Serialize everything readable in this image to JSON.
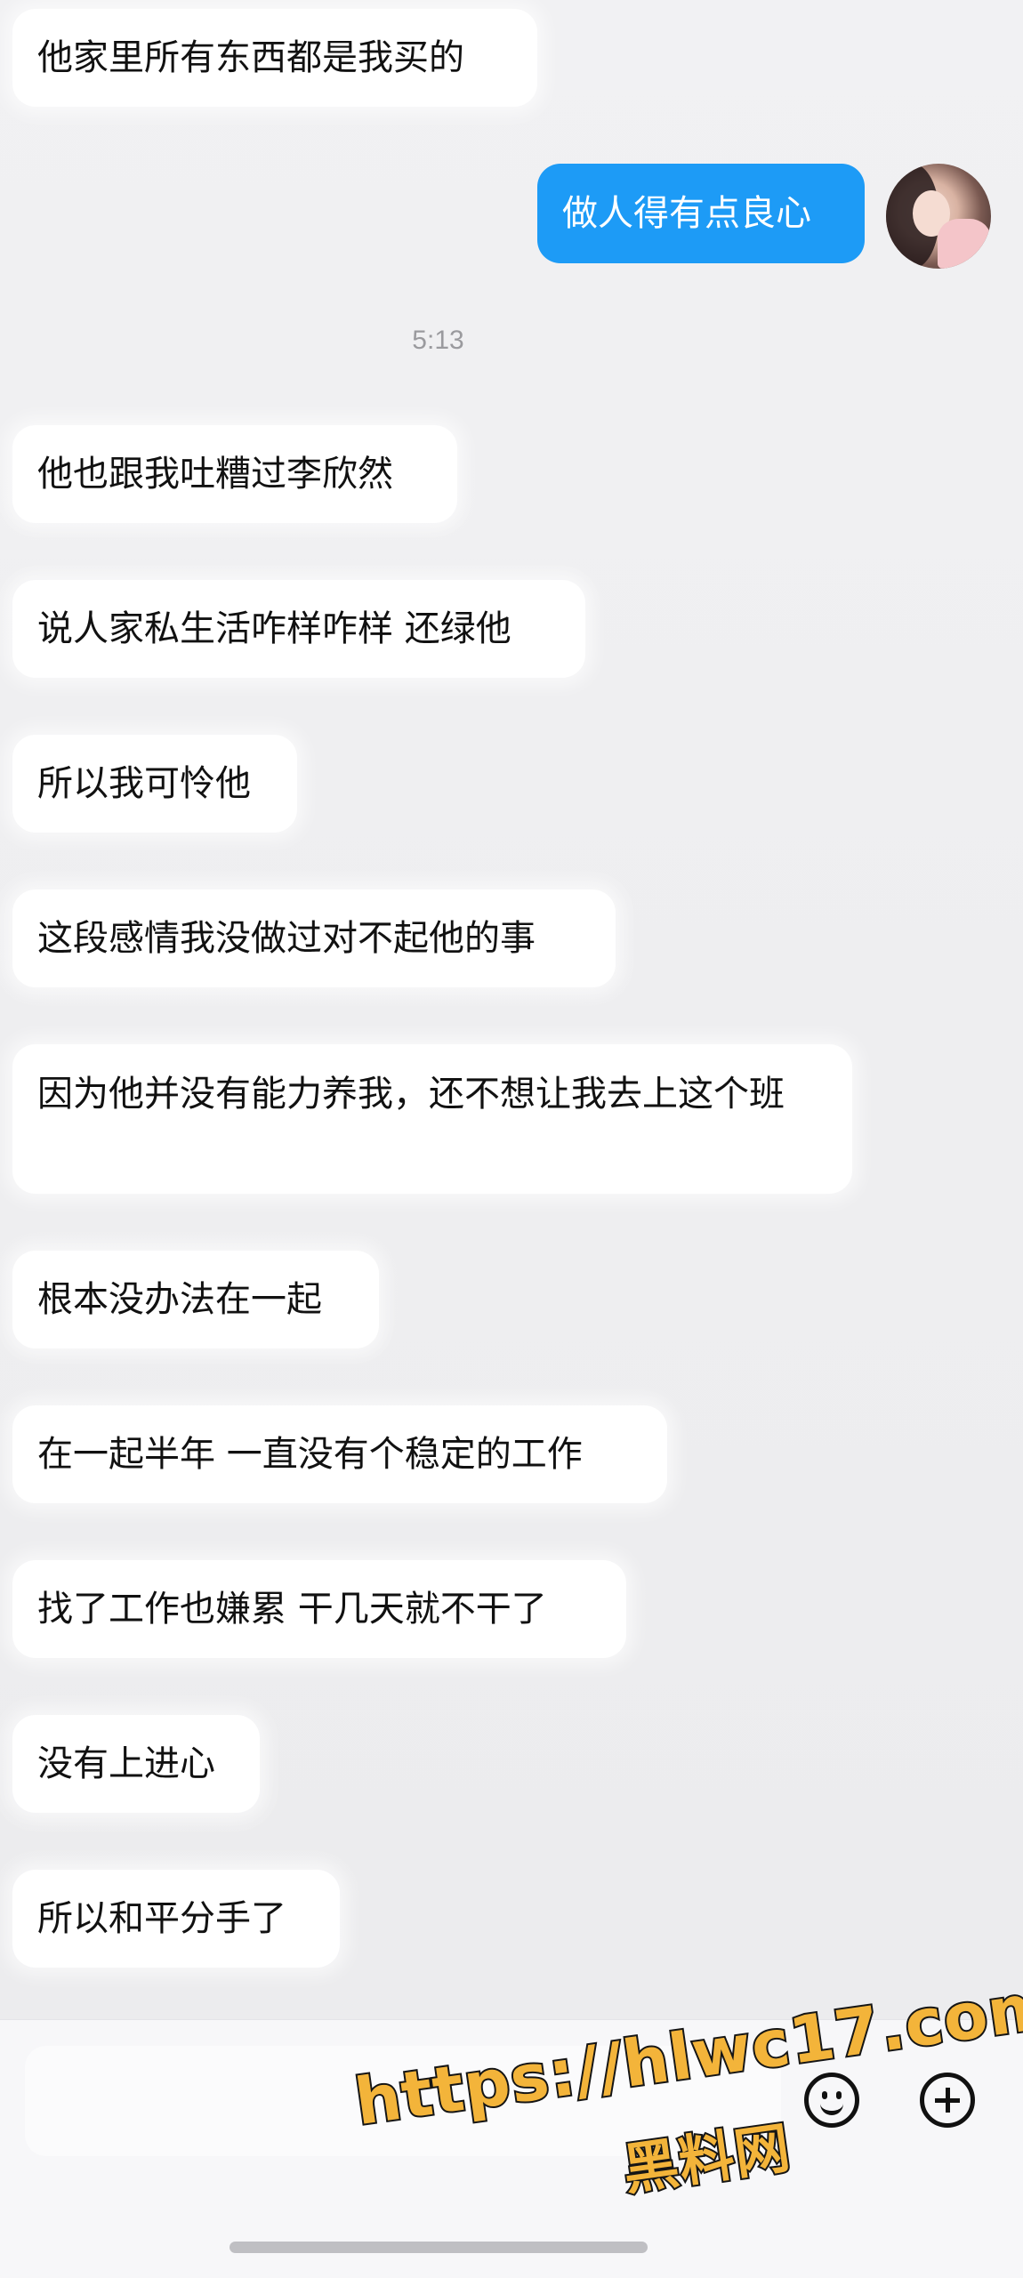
{
  "conversation": {
    "received_1": "他家里所有东西都是我买的",
    "sent_1": "做人得有点良心",
    "timestamp": "5:13",
    "messages": [
      "他也跟我吐糟过李欣然",
      "说人家私生活咋样咋样 还绿他",
      "所以我可怜他",
      "这段感情我没做过对不起他的事",
      "因为他并没有能力养我，还不想让我去上这个班",
      "根本没办法在一起",
      "在一起半年 一直没有个稳定的工作",
      "找了工作也嫌累 干几天就不干了",
      "没有上进心",
      "所以和平分手了"
    ]
  },
  "input_bar": {
    "emoji_icon": "smiley-icon",
    "plus_icon": "plus-circle-icon"
  },
  "watermark": {
    "url": "https://hlwc17.com",
    "name": "黑料网"
  },
  "colors": {
    "sent_bubble": "#1d9bf6",
    "received_bubble": "#ffffff",
    "background": "#efeff1",
    "watermark_fill": "#f3b43a"
  }
}
